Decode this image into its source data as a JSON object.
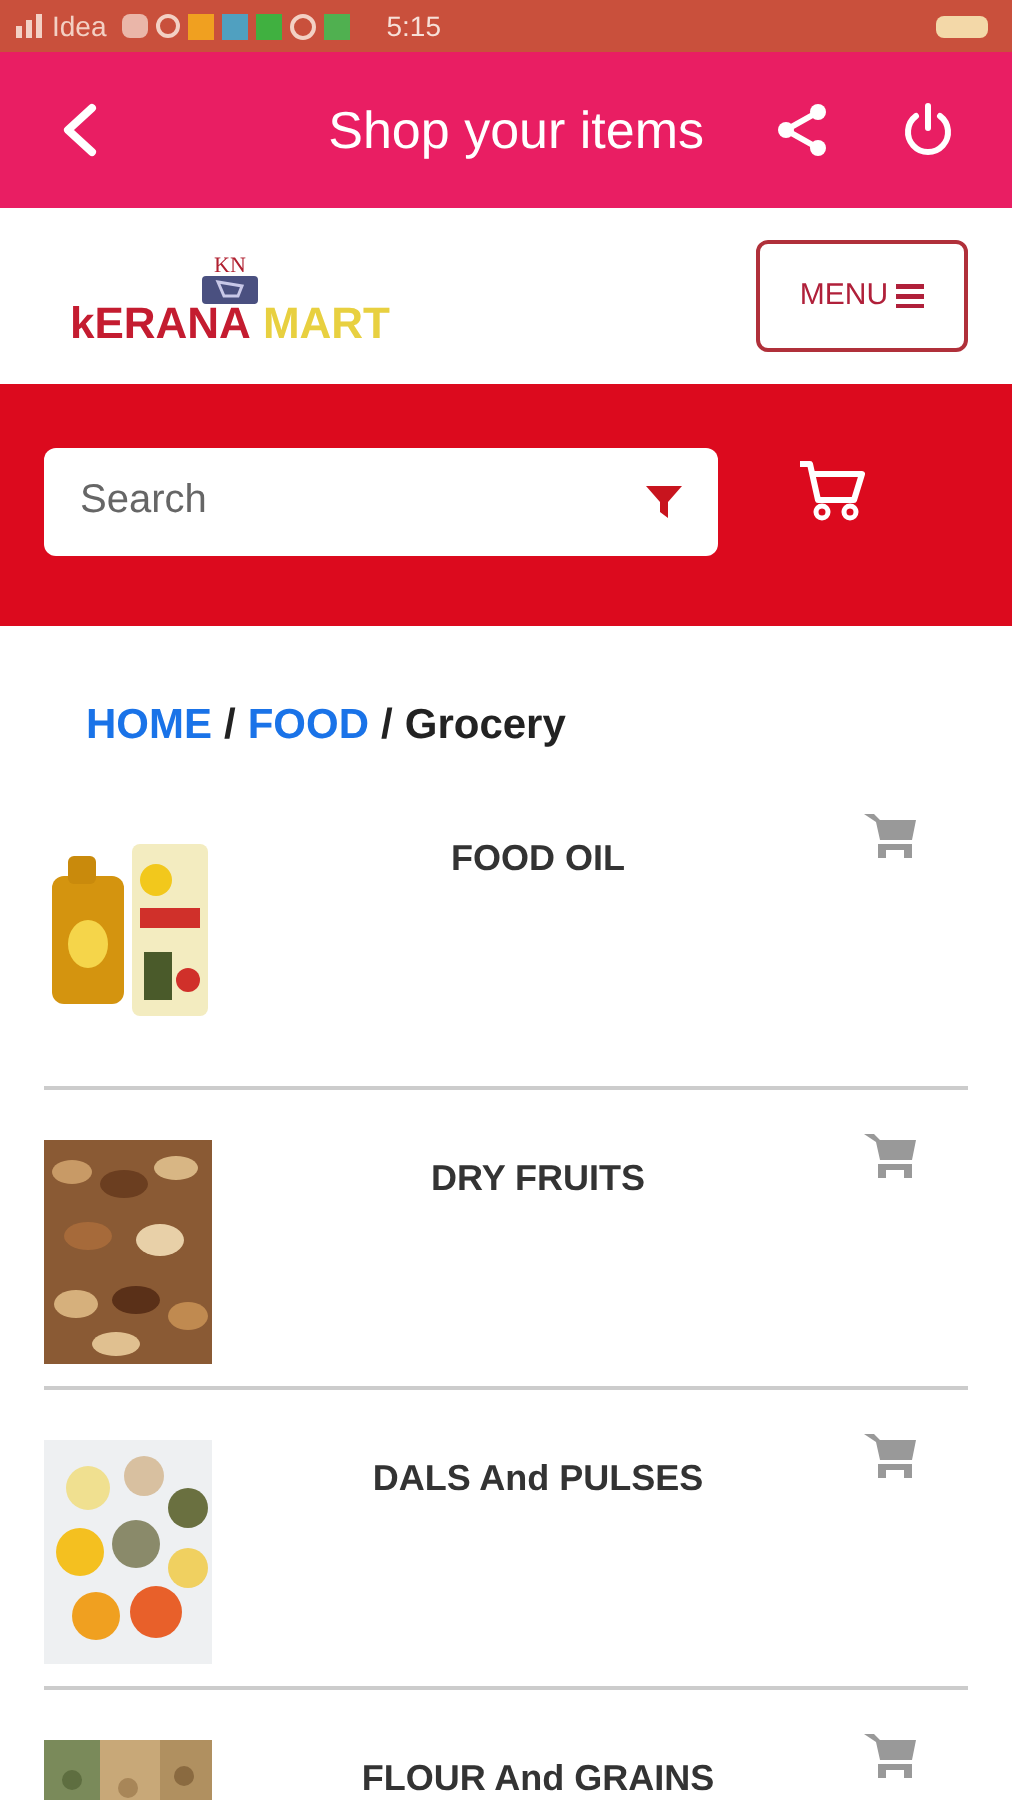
{
  "status_bar": {
    "carrier": "Idea",
    "time": "5:15"
  },
  "app_bar": {
    "title": "Shop your items"
  },
  "header": {
    "logo": {
      "badge": "KN",
      "word_1": "kERANA",
      "word_2": "MART"
    },
    "menu_button": "MENU"
  },
  "search": {
    "placeholder": "Search"
  },
  "breadcrumb": [
    {
      "label": "HOME",
      "kind": "link"
    },
    {
      "label": "FOOD",
      "kind": "link"
    },
    {
      "label": "Grocery",
      "kind": "current"
    }
  ],
  "separator": "/",
  "items": [
    {
      "name": "FOOD OIL"
    },
    {
      "name": "DRY FRUITS"
    },
    {
      "name": "DALS And PULSES"
    },
    {
      "name": "FLOUR And GRAINS"
    }
  ]
}
